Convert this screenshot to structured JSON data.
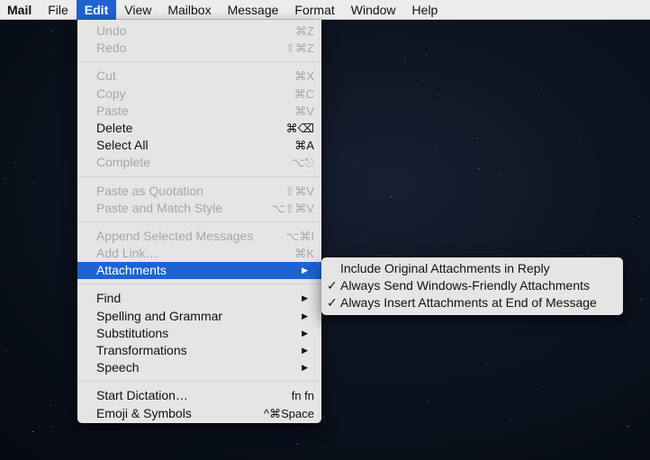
{
  "menubar": {
    "app": "Mail",
    "items": [
      "File",
      "Edit",
      "View",
      "Mailbox",
      "Message",
      "Format",
      "Window",
      "Help"
    ]
  },
  "edit_menu": {
    "undo": {
      "label": "Undo",
      "shortcut": "⌘Z"
    },
    "redo": {
      "label": "Redo",
      "shortcut": "⇧⌘Z"
    },
    "cut": {
      "label": "Cut",
      "shortcut": "⌘X"
    },
    "copy": {
      "label": "Copy",
      "shortcut": "⌘C"
    },
    "paste": {
      "label": "Paste",
      "shortcut": "⌘V"
    },
    "delete": {
      "label": "Delete",
      "shortcut": "⌘⌫"
    },
    "select_all": {
      "label": "Select All",
      "shortcut": "⌘A"
    },
    "complete": {
      "label": "Complete",
      "shortcut": "⌥⎋"
    },
    "paste_quotation": {
      "label": "Paste as Quotation",
      "shortcut": "⇧⌘V"
    },
    "paste_match": {
      "label": "Paste and Match Style",
      "shortcut": "⌥⇧⌘V"
    },
    "append": {
      "label": "Append Selected Messages",
      "shortcut": "⌥⌘I"
    },
    "add_link": {
      "label": "Add Link…",
      "shortcut": "⌘K"
    },
    "attachments": {
      "label": "Attachments"
    },
    "find": {
      "label": "Find"
    },
    "spelling": {
      "label": "Spelling and Grammar"
    },
    "substitutions": {
      "label": "Substitutions"
    },
    "transformations": {
      "label": "Transformations"
    },
    "speech": {
      "label": "Speech"
    },
    "dictation": {
      "label": "Start Dictation…",
      "shortcut": "fn fn"
    },
    "emoji": {
      "label": "Emoji & Symbols",
      "shortcut": "^⌘Space"
    }
  },
  "attachments_submenu": {
    "items": [
      {
        "label": "Include Original Attachments in Reply",
        "checked": false
      },
      {
        "label": "Always Send Windows-Friendly Attachments",
        "checked": true
      },
      {
        "label": "Always Insert Attachments at End of Message",
        "checked": true
      }
    ],
    "check_glyph": "✓"
  },
  "submenu_arrow": "▶",
  "colors": {
    "accent": "#1e63d1",
    "menu_bg": "#ececec",
    "disabled_text": "#a7a7a7"
  }
}
